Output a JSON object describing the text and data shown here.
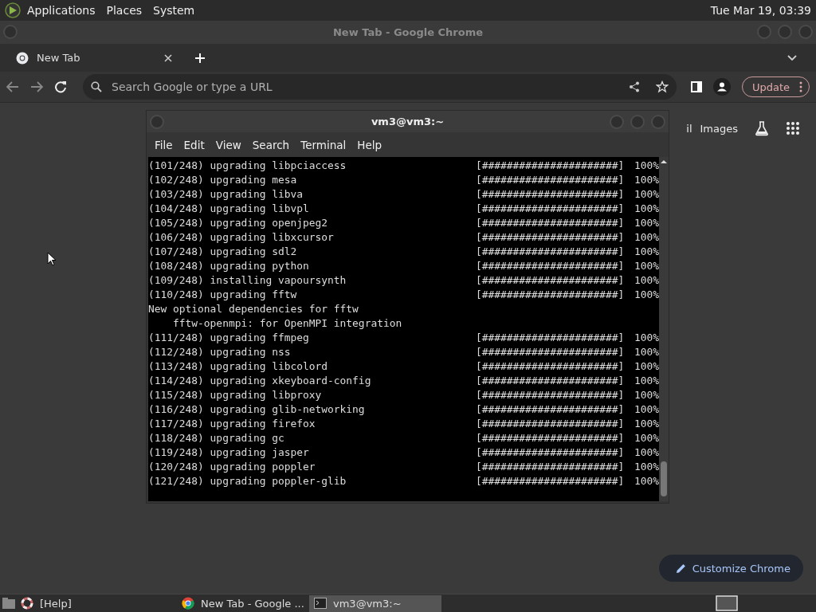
{
  "top_panel": {
    "menus": [
      "Applications",
      "Places",
      "System"
    ],
    "clock": "Tue Mar 19, 03:39"
  },
  "browser": {
    "title": "New Tab - Google Chrome",
    "tabs": [
      {
        "label": "New Tab"
      }
    ],
    "address": {
      "placeholder": "Search Google or type a URL"
    },
    "update_button": "Update",
    "header_links": [
      "il",
      "Images"
    ],
    "customize_button": "Customize Chrome"
  },
  "terminal": {
    "title": "vm3@vm3:~",
    "menus": [
      "File",
      "Edit",
      "View",
      "Search",
      "Terminal",
      "Help"
    ],
    "lines": [
      {
        "kind": "progress",
        "text": "(101/248) upgrading libpciaccess",
        "bar": "[######################]",
        "percent": "100%"
      },
      {
        "kind": "progress",
        "text": "(102/248) upgrading mesa",
        "bar": "[######################]",
        "percent": "100%"
      },
      {
        "kind": "progress",
        "text": "(103/248) upgrading libva",
        "bar": "[######################]",
        "percent": "100%"
      },
      {
        "kind": "progress",
        "text": "(104/248) upgrading libvpl",
        "bar": "[######################]",
        "percent": "100%"
      },
      {
        "kind": "progress",
        "text": "(105/248) upgrading openjpeg2",
        "bar": "[######################]",
        "percent": "100%"
      },
      {
        "kind": "progress",
        "text": "(106/248) upgrading libxcursor",
        "bar": "[######################]",
        "percent": "100%"
      },
      {
        "kind": "progress",
        "text": "(107/248) upgrading sdl2",
        "bar": "[######################]",
        "percent": "100%"
      },
      {
        "kind": "progress",
        "text": "(108/248) upgrading python",
        "bar": "[######################]",
        "percent": "100%"
      },
      {
        "kind": "progress",
        "text": "(109/248) installing vapoursynth",
        "bar": "[######################]",
        "percent": "100%"
      },
      {
        "kind": "progress",
        "text": "(110/248) upgrading fftw",
        "bar": "[######################]",
        "percent": "100%"
      },
      {
        "kind": "text",
        "text": "New optional dependencies for fftw"
      },
      {
        "kind": "text",
        "text": "    fftw-openmpi: for OpenMPI integration"
      },
      {
        "kind": "progress",
        "text": "(111/248) upgrading ffmpeg",
        "bar": "[######################]",
        "percent": "100%"
      },
      {
        "kind": "progress",
        "text": "(112/248) upgrading nss",
        "bar": "[######################]",
        "percent": "100%"
      },
      {
        "kind": "progress",
        "text": "(113/248) upgrading libcolord",
        "bar": "[######################]",
        "percent": "100%"
      },
      {
        "kind": "progress",
        "text": "(114/248) upgrading xkeyboard-config",
        "bar": "[######################]",
        "percent": "100%"
      },
      {
        "kind": "progress",
        "text": "(115/248) upgrading libproxy",
        "bar": "[######################]",
        "percent": "100%"
      },
      {
        "kind": "progress",
        "text": "(116/248) upgrading glib-networking",
        "bar": "[######################]",
        "percent": "100%"
      },
      {
        "kind": "progress",
        "text": "(117/248) upgrading firefox",
        "bar": "[######################]",
        "percent": "100%"
      },
      {
        "kind": "progress",
        "text": "(118/248) upgrading gc",
        "bar": "[######################]",
        "percent": "100%"
      },
      {
        "kind": "progress",
        "text": "(119/248) upgrading jasper",
        "bar": "[######################]",
        "percent": "100%"
      },
      {
        "kind": "progress",
        "text": "(120/248) upgrading poppler",
        "bar": "[######################]",
        "percent": "100%"
      },
      {
        "kind": "progress",
        "text": "(121/248) upgrading poppler-glib",
        "bar": "[######################]",
        "percent": "100%"
      }
    ]
  },
  "taskbar": {
    "items": [
      {
        "kind": "help",
        "label": "[Help]",
        "selected": false
      },
      {
        "kind": "browser",
        "label": "New Tab - Google ...",
        "selected": false
      },
      {
        "kind": "terminal",
        "label": "vm3@vm3:~",
        "selected": true
      }
    ]
  }
}
